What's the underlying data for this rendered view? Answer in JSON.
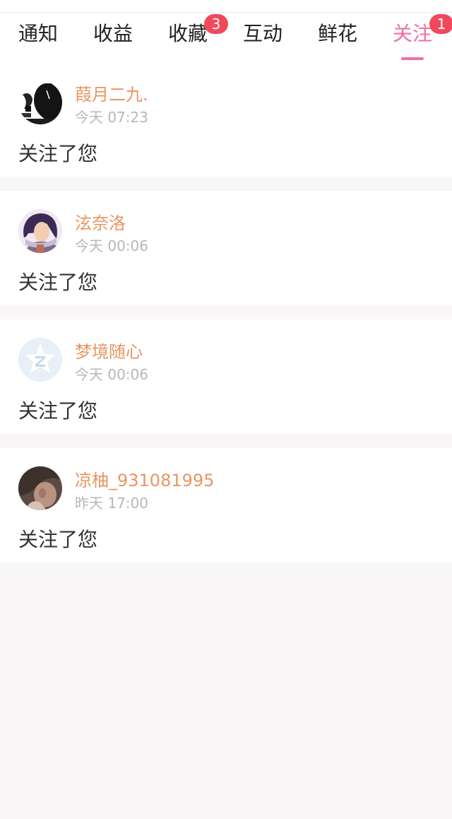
{
  "tabs": [
    {
      "label": "通知",
      "badge": null,
      "active": false
    },
    {
      "label": "收益",
      "badge": null,
      "active": false
    },
    {
      "label": "收藏",
      "badge": "3",
      "active": false
    },
    {
      "label": "互动",
      "badge": null,
      "active": false
    },
    {
      "label": "鲜花",
      "badge": null,
      "active": false
    },
    {
      "label": "关注",
      "badge": "1",
      "active": true
    }
  ],
  "colors": {
    "accent": "#f06fa7",
    "badge": "#f04a5a",
    "username": "#e89563",
    "timestamp": "#b7b7b7"
  },
  "notifications": [
    {
      "username": "葭月二九.",
      "time": "今天 07:23",
      "message": "关注了您",
      "avatar_icon": "sketch-portrait-avatar"
    },
    {
      "username": "泫奈洛",
      "time": "今天 00:06",
      "message": "关注了您",
      "avatar_icon": "anime-character-avatar"
    },
    {
      "username": "梦境随心",
      "time": "今天 00:06",
      "message": "关注了您",
      "avatar_icon": "default-star-avatar"
    },
    {
      "username": "凉柚_931081995",
      "time": "昨天 17:00",
      "message": "关注了您",
      "avatar_icon": "photo-portrait-avatar"
    }
  ]
}
